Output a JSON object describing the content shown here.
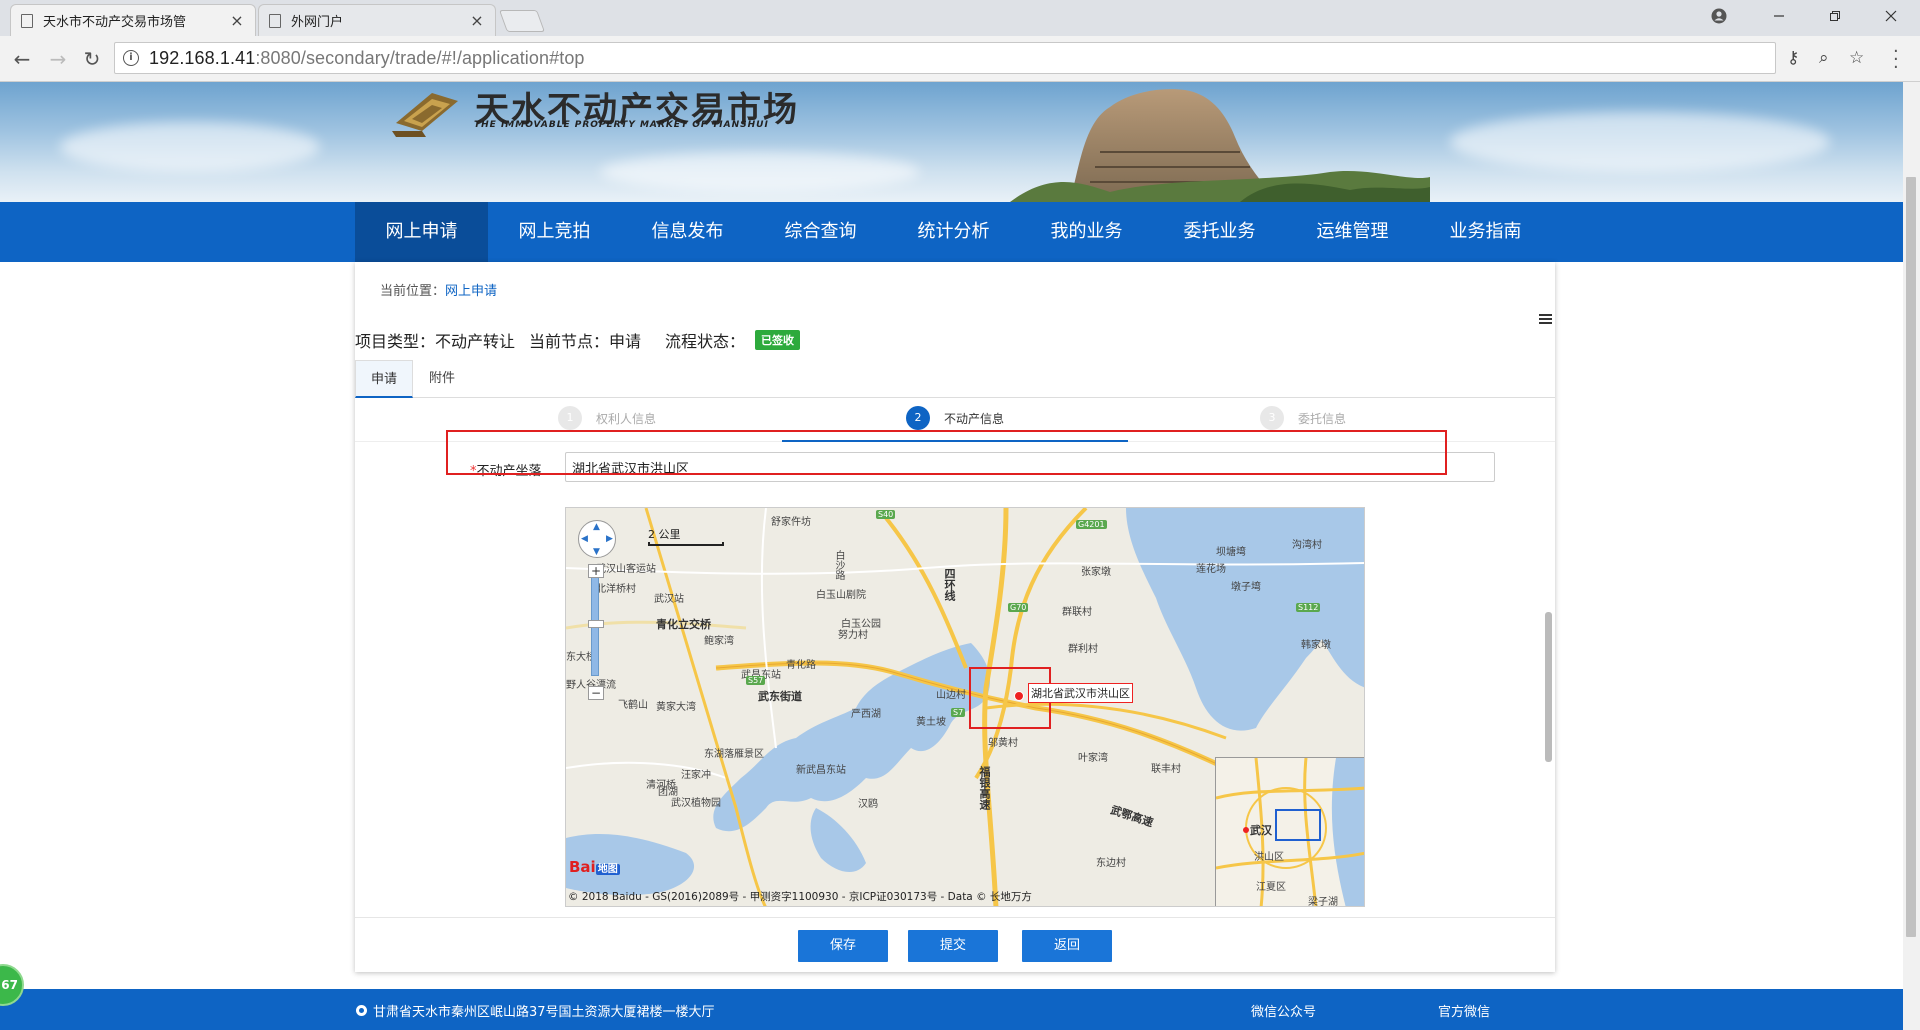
{
  "browser": {
    "tabs": [
      {
        "title": "天水市不动产交易市场管",
        "close": "×"
      },
      {
        "title": "外网门户",
        "close": "×"
      }
    ],
    "url_host": "192.168.1.41",
    "url_rest": ":8080/secondary/trade/#!/application#top",
    "window_controls": [
      "minimize-icon",
      "restore-icon",
      "close-icon"
    ]
  },
  "site": {
    "logo_cn": "天水不动产交易市场",
    "logo_en": "THE IMMOVABLE PROPERTY MARKET OF TIANSHUI",
    "nav": [
      "网上申请",
      "网上竞拍",
      "信息发布",
      "综合查询",
      "统计分析",
      "我的业务",
      "委托业务",
      "运维管理",
      "业务指南"
    ],
    "nav_active": 0
  },
  "breadcrumb": {
    "prefix": "当前位置：",
    "current": "网上申请"
  },
  "project": {
    "type_label": "项目类型：不动产转让",
    "node_label": "当前节点：申请",
    "status_label": "流程状态：",
    "status_badge": "已签收"
  },
  "page_tabs": [
    "申请",
    "附件"
  ],
  "steps": [
    {
      "num": "1",
      "label": "权利人信息"
    },
    {
      "num": "2",
      "label": "不动产信息"
    },
    {
      "num": "3",
      "label": "委托信息"
    }
  ],
  "form": {
    "required_mark": "*",
    "location_label": "不动产坐落",
    "location_value": "湖北省武汉市洪山区"
  },
  "map": {
    "scale": "2 公里",
    "marker_label": "湖北省武汉市洪山区",
    "copyright": "© 2018 Baidu - GS(2016)2089号 - 甲测资字1100930 - 京ICP证030173号 - Data © 长地万方",
    "baidu_logo": "Bai",
    "baidu_logo_suffix": "地图",
    "labels": [
      {
        "t": "舒家仵坊"
      },
      {
        "t": "白玉山剧院"
      },
      {
        "t": "白玉公园"
      },
      {
        "t": "武汉站"
      },
      {
        "t": "青化立交桥"
      },
      {
        "t": "鲍家湾"
      },
      {
        "t": "武昌东站"
      },
      {
        "t": "武东街道"
      },
      {
        "t": "严西湖"
      },
      {
        "t": "黄土坡"
      },
      {
        "t": "东湖落雁景区"
      },
      {
        "t": "新武昌东站"
      },
      {
        "t": "武汉植物园"
      },
      {
        "t": "清河桥"
      },
      {
        "t": "汉鸥"
      },
      {
        "t": "张家墩"
      },
      {
        "t": "群联村"
      },
      {
        "t": "群利村"
      },
      {
        "t": "坝塘塆"
      },
      {
        "t": "莲花场"
      },
      {
        "t": "墩子塆"
      },
      {
        "t": "沟湾村"
      },
      {
        "t": "韩家墩"
      },
      {
        "t": "叶家湾"
      },
      {
        "t": "联丰村"
      },
      {
        "t": "东边村"
      },
      {
        "t": "邬黄村"
      },
      {
        "t": "武鄂高速"
      },
      {
        "t": "福银高速"
      },
      {
        "t": "白沙路"
      },
      {
        "t": "四环线"
      },
      {
        "t": "努力村"
      },
      {
        "t": "青化路"
      },
      {
        "t": "黄家大湾"
      },
      {
        "t": "飞鹤山"
      },
      {
        "t": "山边村"
      },
      {
        "t": "汪家冲"
      },
      {
        "t": "团湖"
      },
      {
        "t": "北洋桥村"
      },
      {
        "t": "武汉山客运站"
      },
      {
        "t": "东大桥"
      },
      {
        "t": "野人谷漂流"
      }
    ],
    "road_tags": [
      "S40",
      "G4201",
      "G70",
      "S57",
      "S7",
      "S112"
    ],
    "overview_labels": [
      "武汉",
      "洪山区",
      "江夏区",
      "梁子湖"
    ]
  },
  "actions": {
    "save": "保存",
    "submit": "提交",
    "back": "返回"
  },
  "footer": {
    "address": "甘肃省天水市秦州区岷山路37号国土资源大厦裙楼一楼大厅",
    "wechat_public": "微信公众号",
    "official_wechat": "官方微信",
    "float_badge": "67"
  }
}
